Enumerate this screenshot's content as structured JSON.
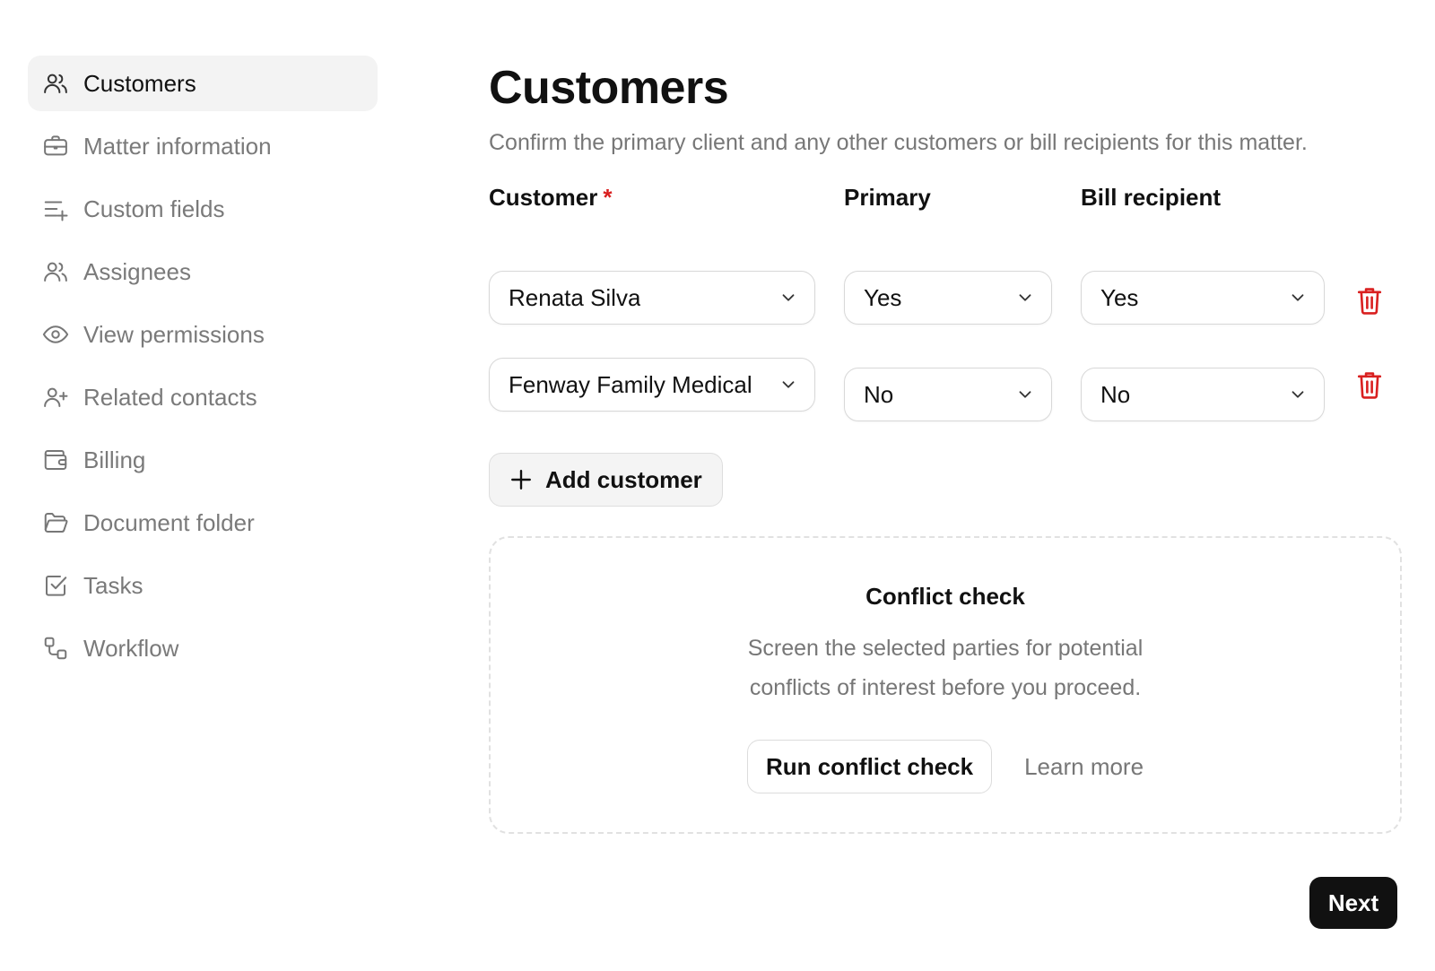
{
  "sidebar": {
    "items": [
      {
        "label": "Customers",
        "icon": "users-icon",
        "active": true
      },
      {
        "label": "Matter information",
        "icon": "briefcase-icon",
        "active": false
      },
      {
        "label": "Custom fields",
        "icon": "list-plus-icon",
        "active": false
      },
      {
        "label": "Assignees",
        "icon": "users-icon",
        "active": false
      },
      {
        "label": "View permissions",
        "icon": "eye-icon",
        "active": false
      },
      {
        "label": "Related contacts",
        "icon": "user-plus-icon",
        "active": false
      },
      {
        "label": "Billing",
        "icon": "wallet-icon",
        "active": false
      },
      {
        "label": "Document folder",
        "icon": "folder-open-icon",
        "active": false
      },
      {
        "label": "Tasks",
        "icon": "checkbox-icon",
        "active": false
      },
      {
        "label": "Workflow",
        "icon": "workflow-icon",
        "active": false
      }
    ]
  },
  "main": {
    "title": "Customers",
    "subtitle": "Confirm the primary client and any other customers or bill recipients for this matter.",
    "columns": {
      "customer": "Customer",
      "required_marker": "*",
      "primary": "Primary",
      "bill_recipient": "Bill recipient"
    },
    "rows": [
      {
        "customer": "Renata Silva",
        "primary": "Yes",
        "bill_recipient": "Yes"
      },
      {
        "customer": "Fenway Family Medical",
        "primary": "No",
        "bill_recipient": "No"
      }
    ],
    "add_customer_label": "Add customer",
    "conflict": {
      "title": "Conflict check",
      "description": "Screen the selected parties for potential conflicts of interest before you proceed.",
      "run_label": "Run conflict check",
      "learn_label": "Learn more"
    },
    "next_label": "Next"
  },
  "colors": {
    "accent_dark": "#111111",
    "danger": "#d92020",
    "muted_text": "#777777",
    "active_nav_bg": "#f3f3f3"
  }
}
